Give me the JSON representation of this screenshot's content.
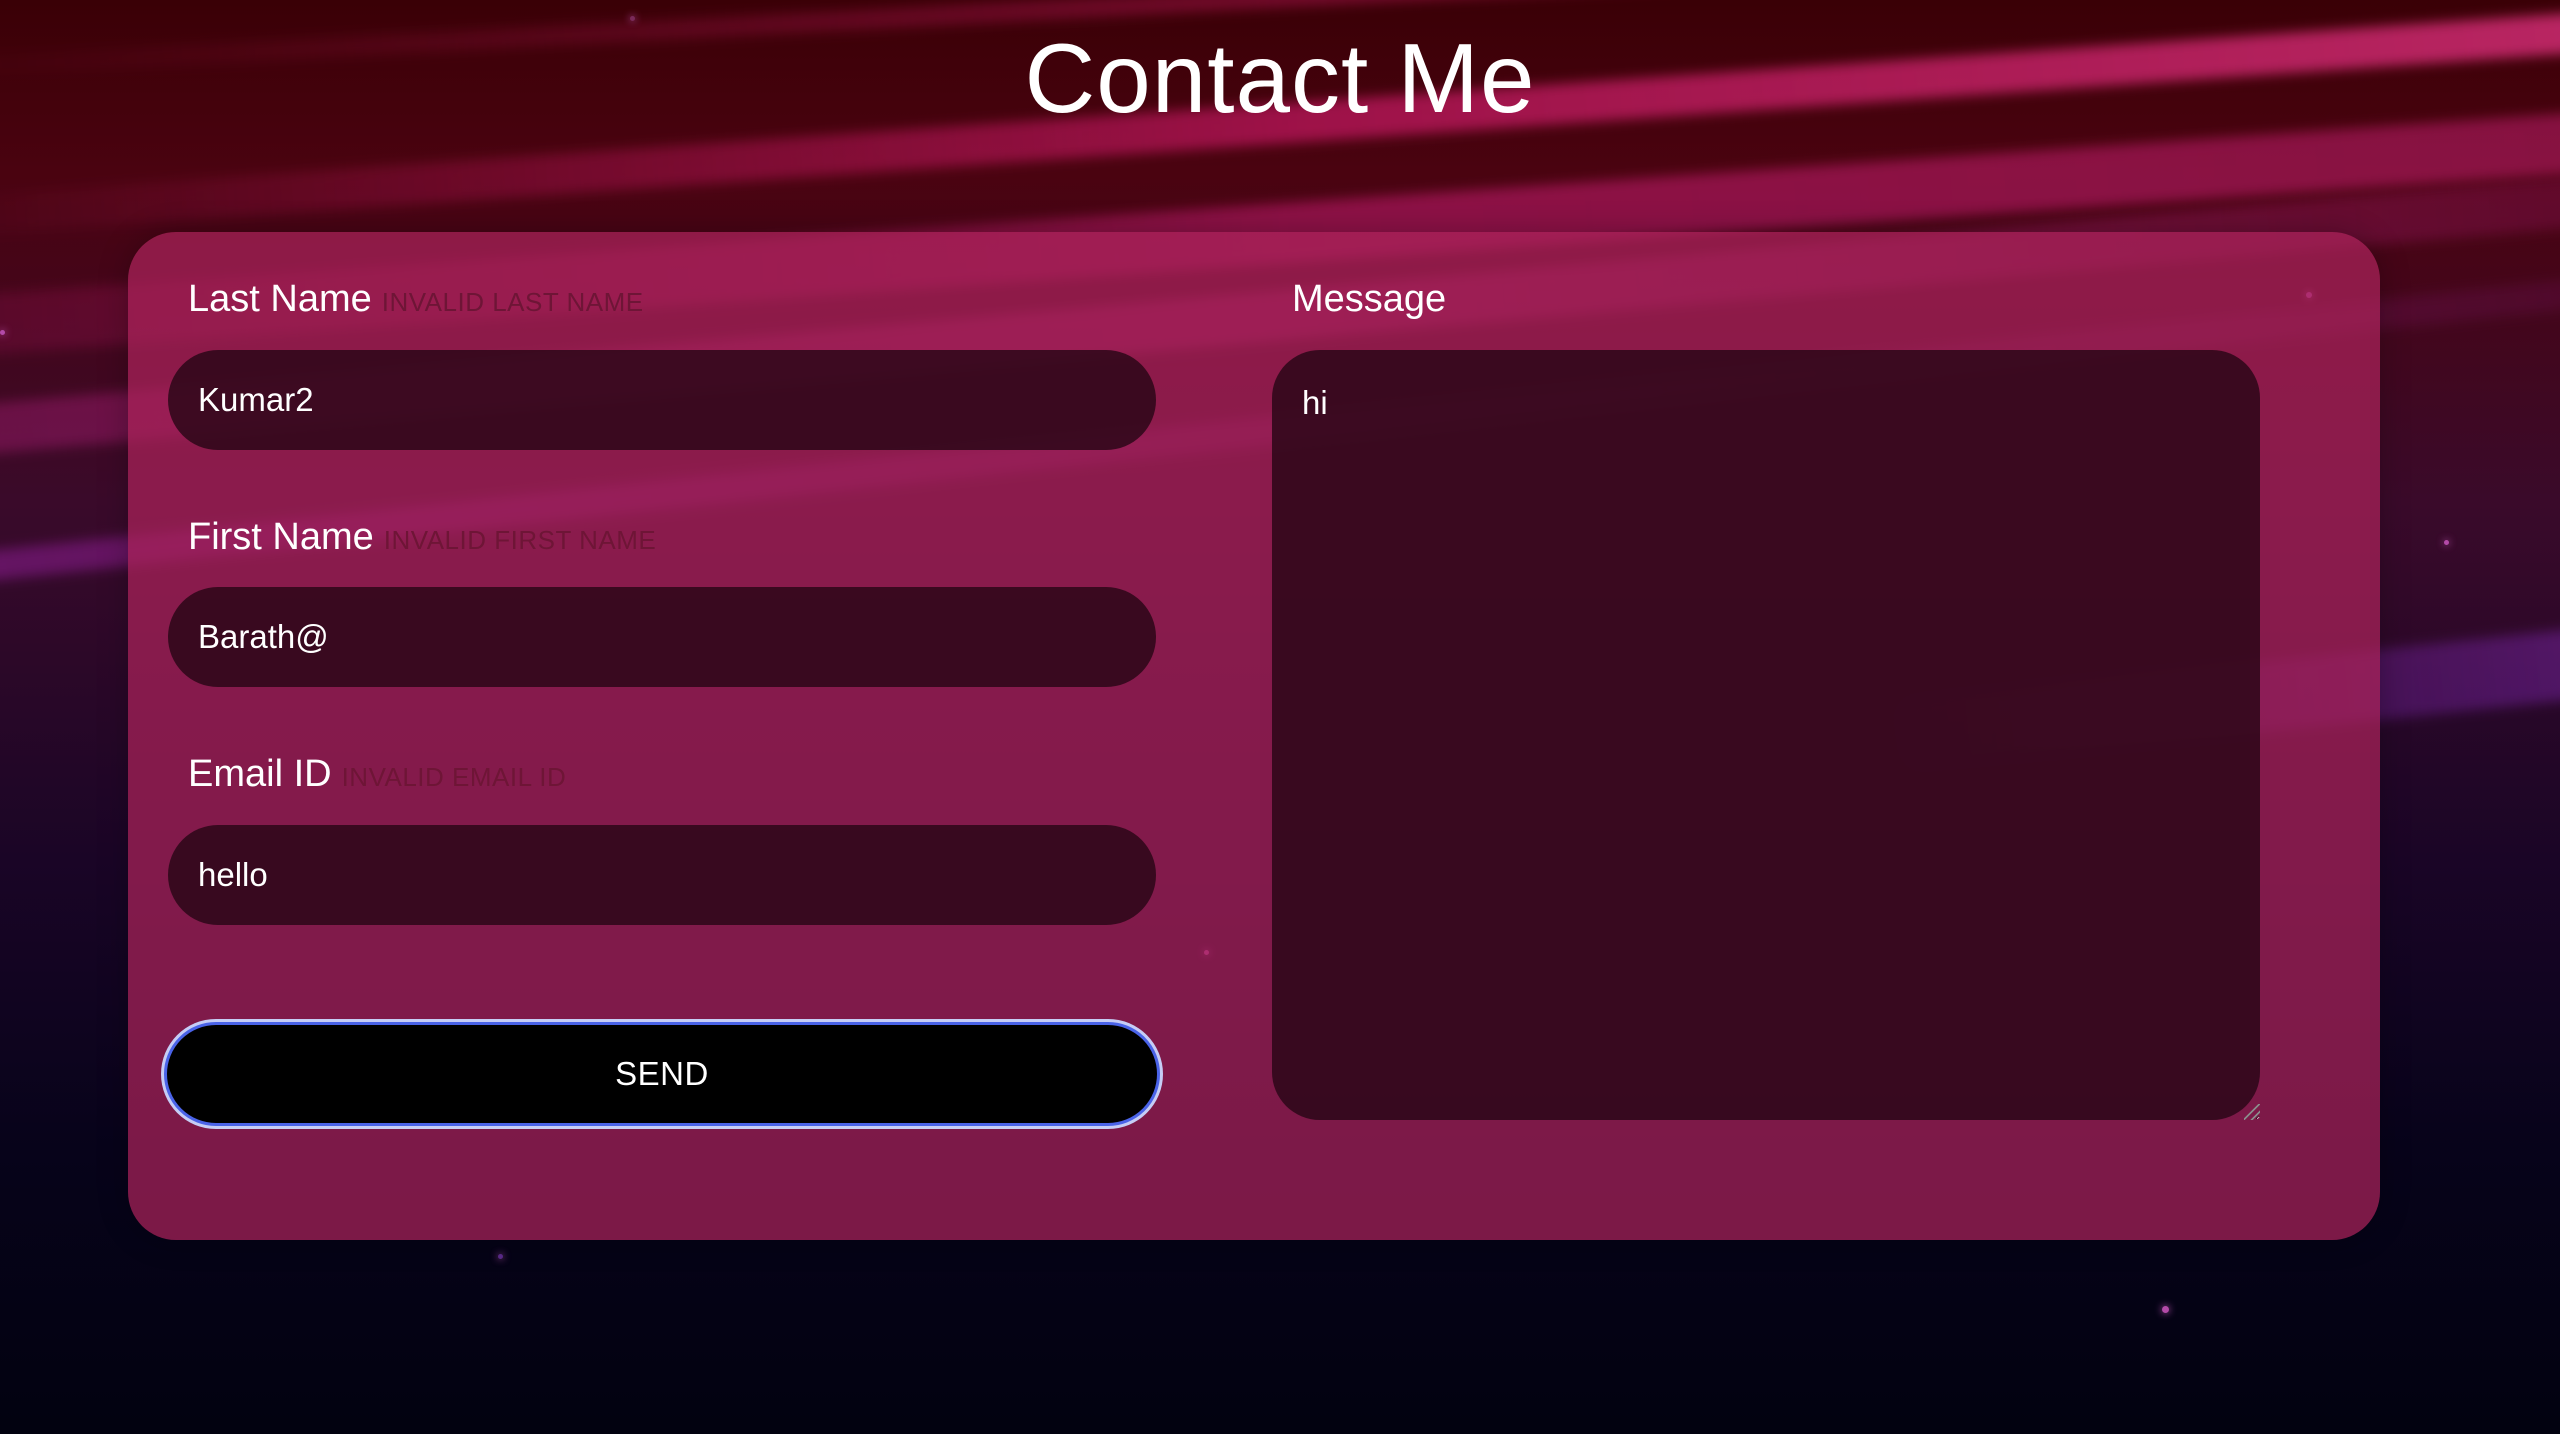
{
  "page": {
    "title": "Contact Me"
  },
  "form": {
    "last_name": {
      "label": "Last Name",
      "error": "INVALID LAST NAME",
      "value": "Kumar2"
    },
    "first_name": {
      "label": "First Name",
      "error": "INVALID FIRST NAME",
      "value": "Barath@"
    },
    "email": {
      "label": "Email ID",
      "error": "INVALID EMAIL ID",
      "value": "hello"
    },
    "message": {
      "label": "Message",
      "value": "hi"
    },
    "send_label": "SEND"
  },
  "colors": {
    "card": "#aa225a",
    "input_bg": "#280616",
    "error_text": "#6e1536",
    "button_bg": "#000000",
    "button_focus_ring": "#4a63e8"
  }
}
